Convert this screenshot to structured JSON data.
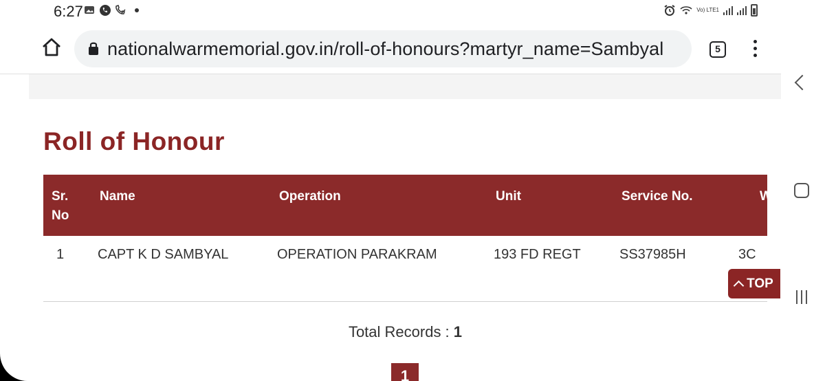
{
  "status_bar": {
    "time": "6:27",
    "network_label": "Vo) LTE1"
  },
  "browser": {
    "url": "nationalwarmemorial.gov.in/roll-of-honours?martyr_name=Sambyal",
    "tab_count": "5",
    "icons": [
      "home-icon",
      "lock-icon",
      "tabs-icon",
      "overflow-menu-icon"
    ]
  },
  "page": {
    "title": "Roll of Honour",
    "table": {
      "headers": [
        "Sr. No",
        "Name",
        "Operation",
        "Unit",
        "Service No.",
        "Wall"
      ],
      "rows": [
        [
          "1",
          "CAPT K D SAMBYAL",
          "OPERATION PARAKRAM",
          "193 FD REGT",
          "SS37985H",
          "3C"
        ]
      ]
    },
    "total_label": "Total Records :",
    "total_value": "1",
    "current_page": "1",
    "top_button": "TOP"
  },
  "colors": {
    "brand_red": "#8b2a2a",
    "title_red": "#8b2525"
  }
}
